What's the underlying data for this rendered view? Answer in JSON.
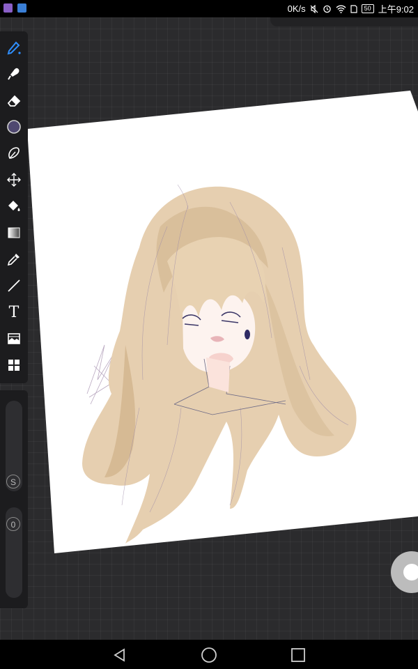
{
  "status_bar": {
    "network_speed": "0K/s",
    "battery": "50",
    "time": "上午9:02",
    "colors": {
      "app_icon_1": "#8a5fc7",
      "app_icon_2": "#3a7fd6"
    }
  },
  "toolbar": {
    "tools": [
      {
        "name": "brush",
        "icon": "brush-icon"
      },
      {
        "name": "smudge",
        "icon": "smudge-icon"
      },
      {
        "name": "eraser",
        "icon": "eraser-icon"
      },
      {
        "name": "color",
        "icon": "color-swatch",
        "color": "#4f4870"
      },
      {
        "name": "lasso",
        "icon": "lasso-icon"
      },
      {
        "name": "transform",
        "icon": "move-icon"
      },
      {
        "name": "fill",
        "icon": "paint-bucket-icon"
      },
      {
        "name": "gradient",
        "icon": "gradient-icon"
      },
      {
        "name": "eyedropper",
        "icon": "eyedropper-icon"
      },
      {
        "name": "line",
        "icon": "line-icon"
      },
      {
        "name": "text",
        "icon": "text-icon"
      },
      {
        "name": "image",
        "icon": "image-icon"
      },
      {
        "name": "layers",
        "icon": "layers-grid-icon"
      }
    ],
    "text_tool_label": "T",
    "accent": "#2f8fff"
  },
  "sliders": {
    "size_label": "S",
    "opacity_label": "0"
  },
  "canvas": {
    "background": "#2b2b2d",
    "paper_color": "#ffffff",
    "hair_color": "#e8d2b2",
    "hair_shadow": "#d8bb95",
    "earring_color": "#2f2a63"
  },
  "nav": {
    "back": "back-icon",
    "home": "home-icon",
    "recents": "recents-icon"
  }
}
